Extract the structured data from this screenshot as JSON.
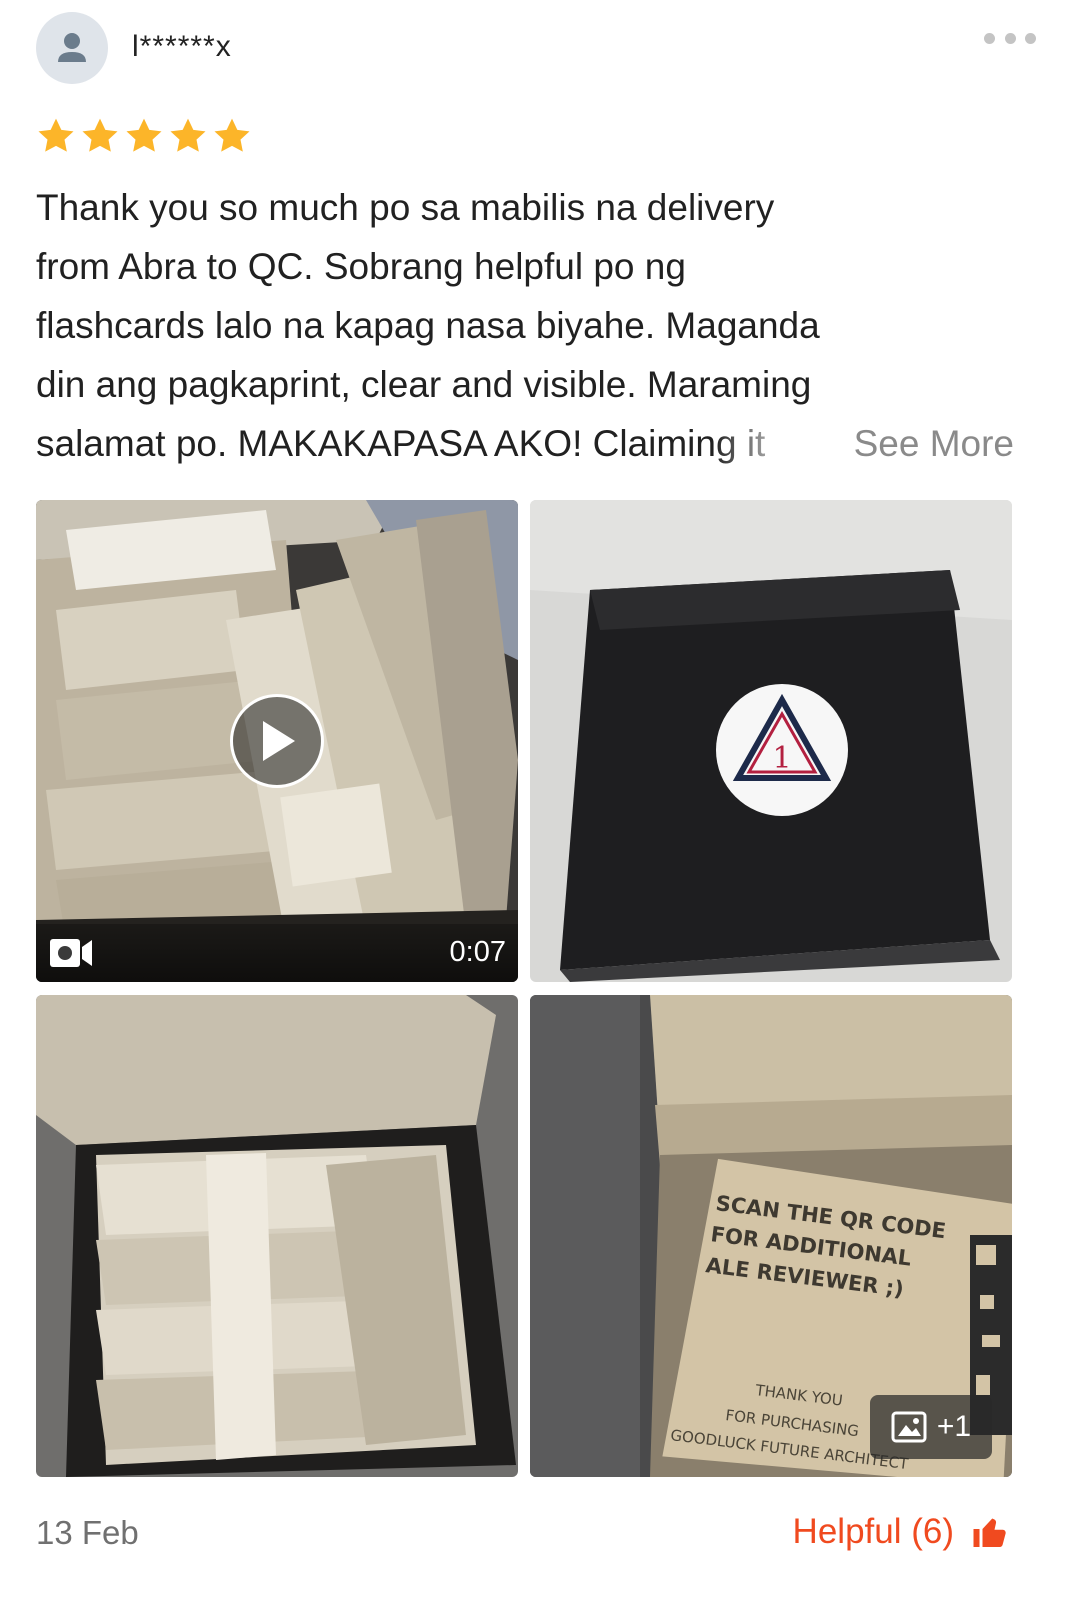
{
  "reviewer": {
    "name": "l******x",
    "avatar_icon": "user-silhouette-icon"
  },
  "rating": {
    "stars": 5,
    "max": 5,
    "color": "#fcb529"
  },
  "review": {
    "lines": [
      "Thank you so much po sa mabilis na delivery",
      "from Abra to QC. Sobrang helpful po ng",
      "flashcards lalo na kapag nasa biyahe. Maganda",
      "din ang pagkaprint, clear and visible. Maraming",
      "salamat po. MAKAKAPASA AKO! Claiming it"
    ],
    "see_more_label": "See More"
  },
  "media": {
    "video_duration": "0:07",
    "video_icon": "video-camera-icon",
    "play_icon": "play-icon",
    "photo2_sticker_text": "1",
    "photo4_card_lines": [
      "SCAN THE QR CODE",
      "FOR ADDITIONAL",
      "ALE REVIEWER ;)"
    ],
    "photo4_footer_lines": [
      "THANK YOU",
      "FOR PURCHASING",
      "GOODLUCK FUTURE ARCHITECT"
    ],
    "more_count_label": "+1",
    "more_icon": "image-icon"
  },
  "footer": {
    "date": "13 Feb",
    "helpful_label": "Helpful (6)",
    "helpful_icon": "thumbs-up-icon",
    "accent_color": "#f04a1f"
  }
}
